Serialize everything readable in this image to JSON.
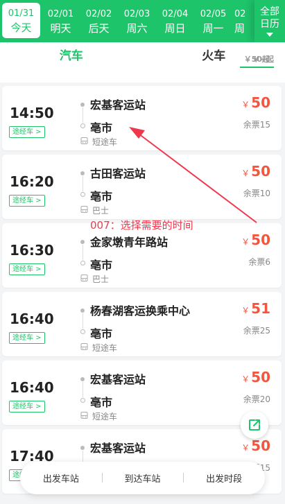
{
  "dates": [
    {
      "date": "01/31",
      "weekday": "今天",
      "active": true
    },
    {
      "date": "02/01",
      "weekday": "明天"
    },
    {
      "date": "02/02",
      "weekday": "后天"
    },
    {
      "date": "02/03",
      "weekday": "周六"
    },
    {
      "date": "02/04",
      "weekday": "周日"
    },
    {
      "date": "02/05",
      "weekday": "周一"
    },
    {
      "date": "02",
      "weekday": "周"
    }
  ],
  "all_dates": {
    "line1": "全部",
    "line2": "日历"
  },
  "modes": [
    {
      "name": "汽车",
      "price": "￥50起",
      "active": true
    },
    {
      "name": "火车",
      "price": "￥--起"
    }
  ],
  "trips": [
    {
      "time": "14:50",
      "via": "途经车 >",
      "from": "宏基客运站",
      "to": "亳市",
      "type": "短途车",
      "currency": "￥",
      "price": "50",
      "seats": "余票15"
    },
    {
      "time": "16:20",
      "via": "途经车 >",
      "from": "古田客运站",
      "to": "亳市",
      "type": "巴士",
      "currency": "￥",
      "price": "50",
      "seats": "余票10"
    },
    {
      "time": "16:30",
      "via": "途经车 >",
      "from": "金家墩青年路站",
      "to": "亳市",
      "type": "巴士",
      "currency": "￥",
      "price": "50",
      "seats": "余票6"
    },
    {
      "time": "16:40",
      "via": "途经车 >",
      "from": "杨春湖客运换乘中心",
      "to": "亳市",
      "type": "短途车",
      "currency": "￥",
      "price": "51",
      "seats": "余票25"
    },
    {
      "time": "16:40",
      "via": "途经车 >",
      "from": "宏基客运站",
      "to": "亳市",
      "type": "短途车",
      "currency": "￥",
      "price": "50",
      "seats": "余票20"
    },
    {
      "time": "17:40",
      "via": "途经车 >",
      "from": "宏基客运站",
      "to": "亳市",
      "type": "短途车",
      "currency": "￥",
      "price": "50",
      "seats": "余票15"
    }
  ],
  "annotation": "007：选择需要的时间",
  "filters": [
    "出发车站",
    "到达车站",
    "出发时段"
  ],
  "colors": {
    "brand": "#1ec46a",
    "price": "#f2563f",
    "annotation": "#f0384d"
  }
}
